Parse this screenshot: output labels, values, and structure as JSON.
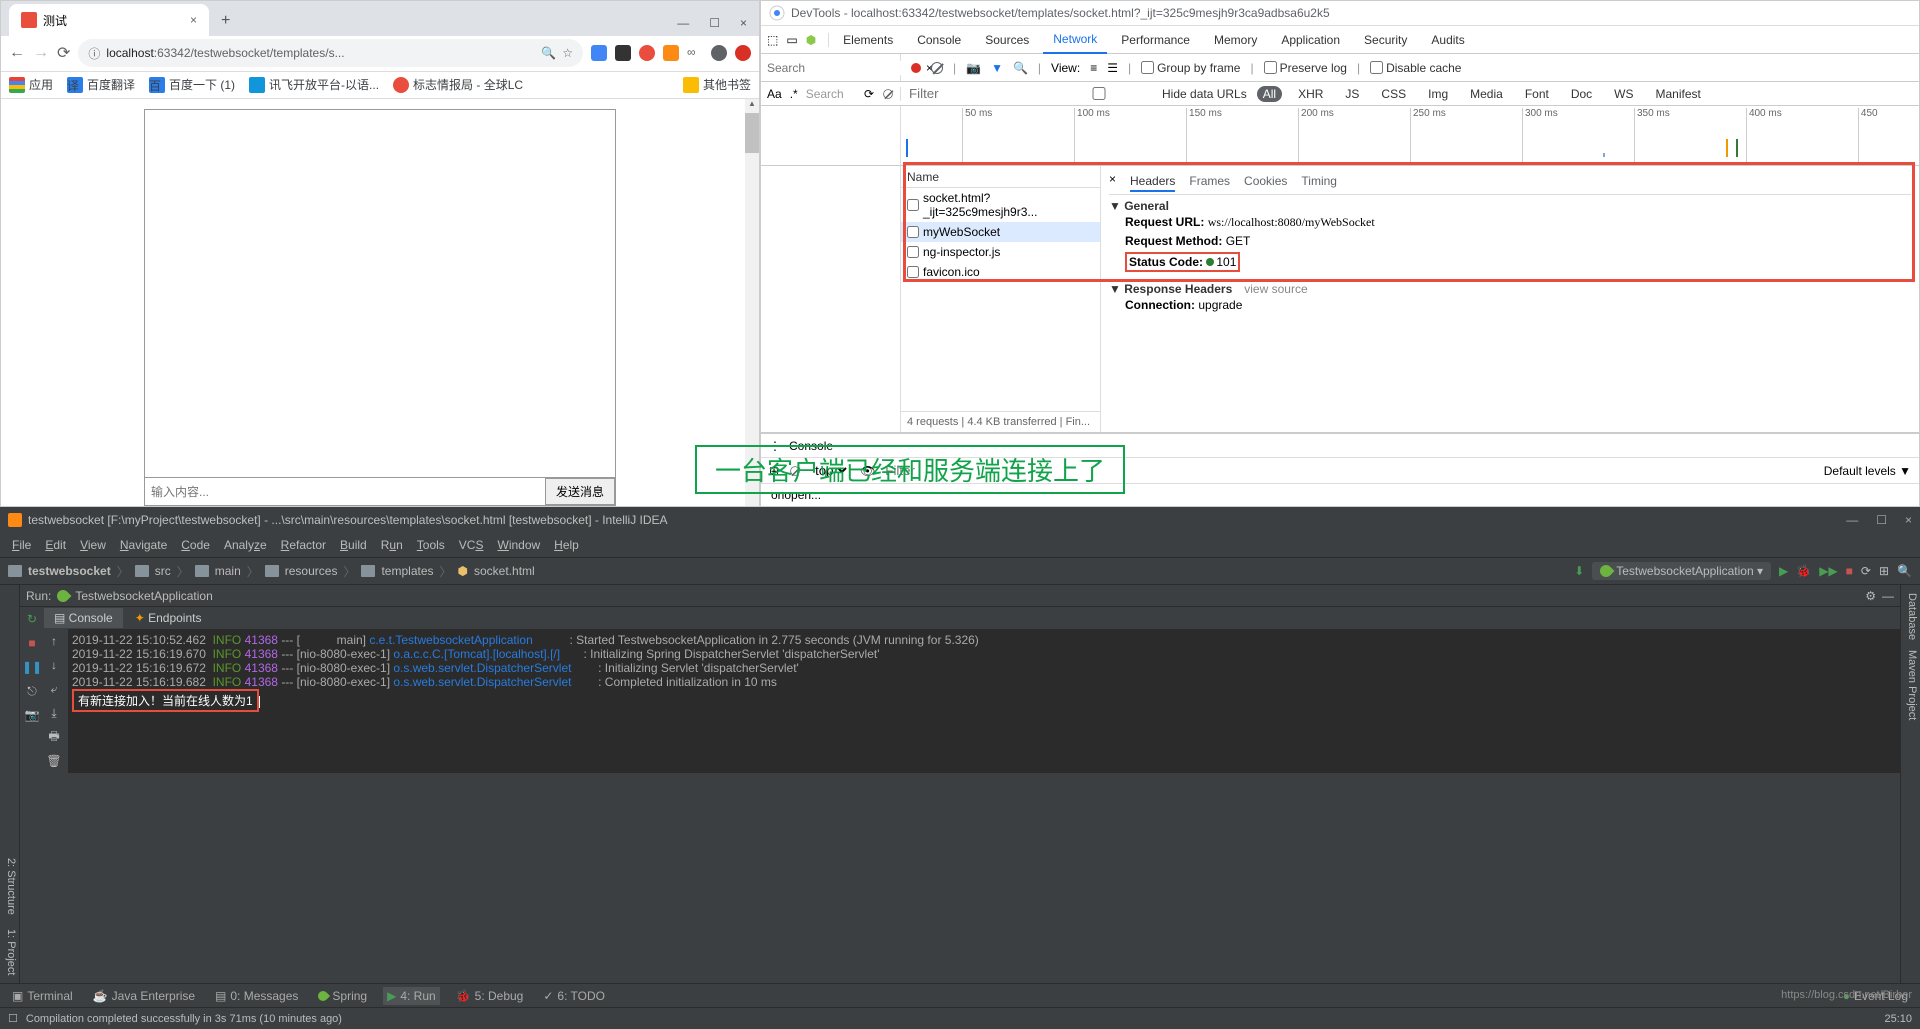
{
  "chrome": {
    "tab_title": "测试",
    "url_host": "localhost",
    "url_path": ":63342/testwebsocket/templates/s...",
    "bookmarks": {
      "apps": "应用",
      "baidu_translate": "百度翻译",
      "baidu": "百度一下 (1)",
      "iflytek": "讯飞开放平台-以语...",
      "biaozhi": "标志情报局 - 全球LC",
      "other": "其他书签"
    },
    "page": {
      "input_placeholder": "输入内容...",
      "send_button": "发送消息"
    }
  },
  "devtools": {
    "title": "DevTools - localhost:63342/testwebsocket/templates/socket.html?_ijt=325c9mesjh9r3ca9adbsa6u2k5",
    "tabs": {
      "elements": "Elements",
      "console": "Console",
      "sources": "Sources",
      "network": "Network",
      "performance": "Performance",
      "memory": "Memory",
      "application": "Application",
      "security": "Security",
      "audits": "Audits"
    },
    "toolbar": {
      "search": "Search",
      "view_label": "View:",
      "group_by_frame": "Group by frame",
      "preserve_log": "Preserve log",
      "disable_cache": "Disable cache"
    },
    "filterbar": {
      "filter": "Filter",
      "hide_data_urls": "Hide data URLs",
      "all": "All",
      "xhr": "XHR",
      "js": "JS",
      "css": "CSS",
      "img": "Img",
      "media": "Media",
      "font": "Font",
      "doc": "Doc",
      "ws": "WS",
      "manifest": "Manifest"
    },
    "ticks": [
      "50 ms",
      "100 ms",
      "150 ms",
      "200 ms",
      "250 ms",
      "300 ms",
      "350 ms",
      "400 ms",
      "450"
    ],
    "requests": {
      "header": "Name",
      "list": [
        "socket.html?_ijt=325c9mesjh9r3...",
        "myWebSocket",
        "ng-inspector.js",
        "favicon.ico"
      ],
      "status": "4 requests  |  4.4 KB transferred  |  Fin..."
    },
    "detail": {
      "tab_headers": "Headers",
      "tab_frames": "Frames",
      "tab_cookies": "Cookies",
      "tab_timing": "Timing",
      "general": "General",
      "request_url_label": "Request URL:",
      "request_url": "ws://localhost:8080/myWebSocket",
      "request_method_label": "Request Method:",
      "request_method": "GET",
      "status_code_label": "Status Code:",
      "status_code": "101",
      "response_headers": "Response Headers",
      "view_source": "view source",
      "connection_label": "Connection:",
      "connection": "upgrade"
    },
    "drawer": {
      "console_label": "Console",
      "top": "top",
      "filter": "Filter",
      "default_levels": "Default levels ▼",
      "onopen": "onopen..."
    }
  },
  "annotation": "一台客户端已经和服务端连接上了",
  "idea": {
    "title": "testwebsocket [F:\\myProject\\testwebsocket] - ...\\src\\main\\resources\\templates\\socket.html [testwebsocket] - IntelliJ IDEA",
    "menu": {
      "file": "File",
      "edit": "Edit",
      "view": "View",
      "navigate": "Navigate",
      "code": "Code",
      "analyze": "Analyze",
      "refactor": "Refactor",
      "build": "Build",
      "run": "Run",
      "tools": "Tools",
      "vcs": "VCS",
      "window": "Window",
      "help": "Help"
    },
    "breadcrumbs": [
      "testwebsocket",
      "src",
      "main",
      "resources",
      "templates",
      "socket.html"
    ],
    "run_config": "TestwebsocketApplication ▾",
    "run_label": "Run:",
    "run_app": "TestwebsocketApplication",
    "run_tabs": {
      "console": "Console",
      "endpoints": "Endpoints"
    },
    "log": [
      {
        "ts": "2019-11-22 15:10:52.462",
        "lvl": "INFO",
        "pid": "41368",
        "thread": "[           main]",
        "cls": "c.e.t.TestwebsocketApplication          ",
        "msg": ": Started TestwebsocketApplication in 2.775 seconds (JVM running for 5.326)"
      },
      {
        "ts": "2019-11-22 15:16:19.670",
        "lvl": "INFO",
        "pid": "41368",
        "thread": "[nio-8080-exec-1]",
        "cls": "o.a.c.c.C.[Tomcat].[localhost].[/]      ",
        "msg": ": Initializing Spring DispatcherServlet 'dispatcherServlet'"
      },
      {
        "ts": "2019-11-22 15:16:19.672",
        "lvl": "INFO",
        "pid": "41368",
        "thread": "[nio-8080-exec-1]",
        "cls": "o.s.web.servlet.DispatcherServlet       ",
        "msg": ": Initializing Servlet 'dispatcherServlet'"
      },
      {
        "ts": "2019-11-22 15:16:19.682",
        "lvl": "INFO",
        "pid": "41368",
        "thread": "[nio-8080-exec-1]",
        "cls": "o.s.web.servlet.DispatcherServlet       ",
        "msg": ": Completed initialization in 10 ms"
      }
    ],
    "connect_msg": "有新连接加入！当前在线人数为1",
    "leftgutter": [
      "2: Structure",
      "1: Project"
    ],
    "rightgutter": [
      "Database",
      "Maven Project"
    ],
    "bottom": {
      "terminal": "Terminal",
      "java_ee": "Java Enterprise",
      "messages": "0: Messages",
      "spring": "Spring",
      "run": "4: Run",
      "debug": "5: Debug",
      "todo": "6: TODO",
      "event_log": "Event Log"
    },
    "status": "Compilation completed successfully in 3s 71ms (10 minutes ago)",
    "status_right": "25:10",
    "watermark": "https://blog.csdn.net/Birber"
  }
}
